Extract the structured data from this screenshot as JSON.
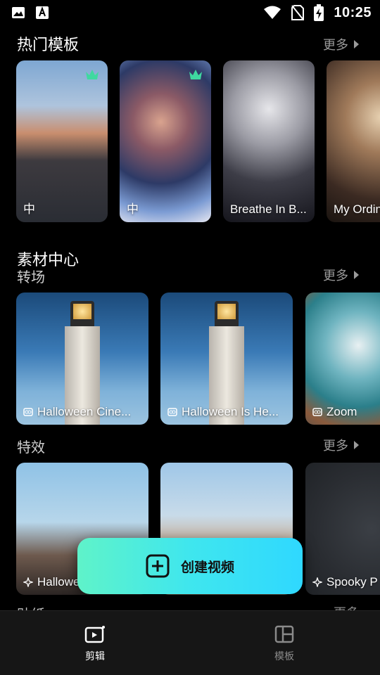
{
  "status_bar": {
    "time": "10:25"
  },
  "hot_templates": {
    "title": "热门模板",
    "more": "更多",
    "items": [
      {
        "label": "中",
        "premium": true
      },
      {
        "label": "中",
        "premium": true
      },
      {
        "label": "Breathe In B...",
        "premium": false
      },
      {
        "label": "My Ordin",
        "premium": false
      }
    ]
  },
  "materials": {
    "title": "素材中心",
    "transitions": {
      "title": "转场",
      "more": "更多",
      "items": [
        {
          "label": "Halloween Cine..."
        },
        {
          "label": "Halloween Is He..."
        },
        {
          "label": "Zoom"
        }
      ]
    },
    "effects": {
      "title": "特效",
      "more": "更多",
      "items": [
        {
          "label": "Hallowe"
        },
        {
          "label": ""
        },
        {
          "label": "Spooky P"
        }
      ]
    },
    "stickers_peek": {
      "title": "贴纸",
      "more": "更多"
    }
  },
  "create_button": {
    "label": "创建视频"
  },
  "bottom_nav": {
    "items": [
      {
        "label": "剪辑",
        "active": true
      },
      {
        "label": "模板",
        "active": false
      }
    ]
  },
  "colors": {
    "accent_start": "#5ff3c9",
    "accent_end": "#2fd8ff",
    "crown": "#3fd9a0"
  }
}
